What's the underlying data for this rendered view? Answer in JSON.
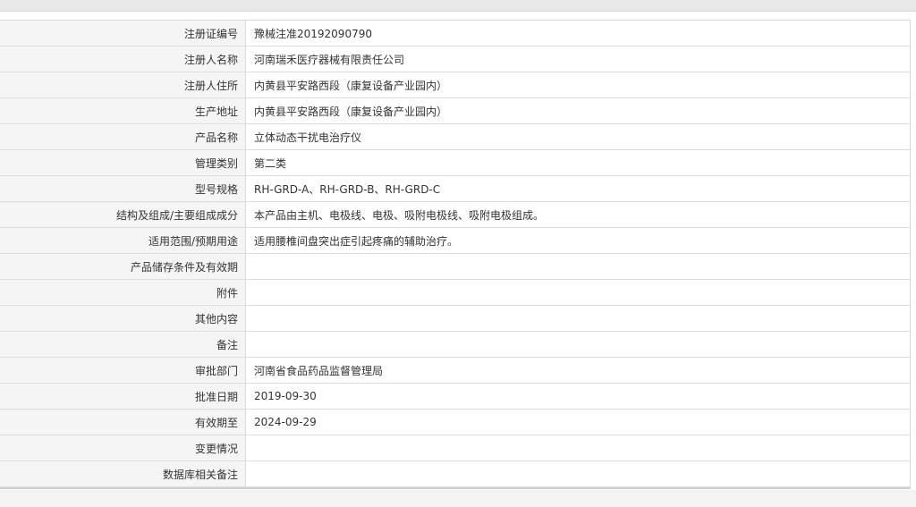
{
  "fields": [
    {
      "label": "注册证编号",
      "value": "豫械注准20192090790"
    },
    {
      "label": "注册人名称",
      "value": "河南瑞禾医疗器械有限责任公司"
    },
    {
      "label": "注册人住所",
      "value": "内黄县平安路西段（康复设备产业园内）"
    },
    {
      "label": "生产地址",
      "value": "内黄县平安路西段（康复设备产业园内）"
    },
    {
      "label": "产品名称",
      "value": "立体动态干扰电治疗仪"
    },
    {
      "label": "管理类别",
      "value": "第二类"
    },
    {
      "label": "型号规格",
      "value": "RH-GRD-A、RH-GRD-B、RH-GRD-C"
    },
    {
      "label": "结构及组成/主要组成成分",
      "value": "本产品由主机、电极线、电极、吸附电极线、吸附电极组成。"
    },
    {
      "label": "适用范围/预期用途",
      "value": "适用腰椎间盘突出症引起疼痛的辅助治疗。"
    },
    {
      "label": "产品储存条件及有效期",
      "value": ""
    },
    {
      "label": "附件",
      "value": ""
    },
    {
      "label": "其他内容",
      "value": ""
    },
    {
      "label": "备注",
      "value": ""
    },
    {
      "label": "审批部门",
      "value": "河南省食品药品监督管理局"
    },
    {
      "label": "批准日期",
      "value": "2019-09-30"
    },
    {
      "label": "有效期至",
      "value": "2024-09-29"
    },
    {
      "label": "变更情况",
      "value": ""
    },
    {
      "label": "数据库相关备注",
      "value": ""
    }
  ]
}
